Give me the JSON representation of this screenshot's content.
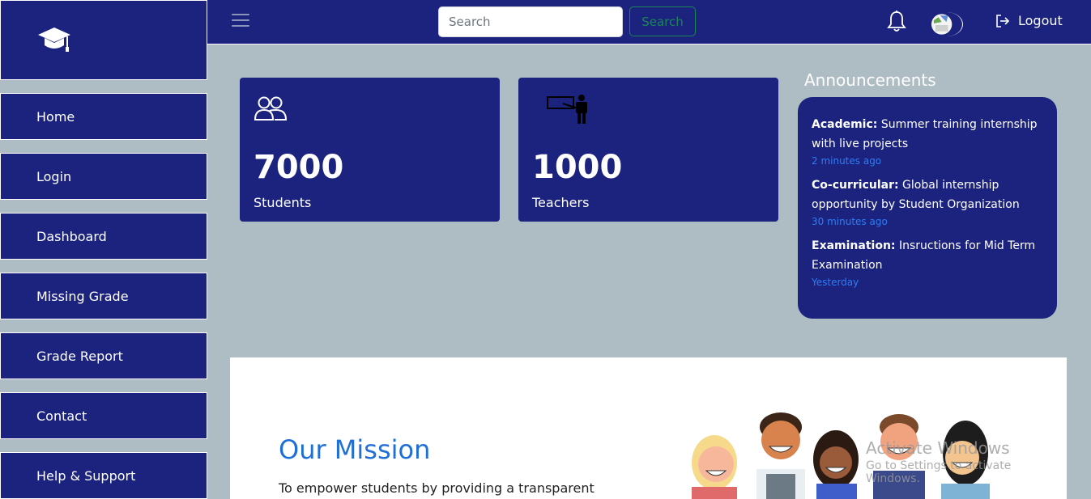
{
  "sidebar": {
    "logo_icon": "graduation-cap-icon",
    "items": [
      {
        "label": "Home"
      },
      {
        "label": "Login"
      },
      {
        "label": "Dashboard"
      },
      {
        "label": "Missing Grade"
      },
      {
        "label": "Grade Report"
      },
      {
        "label": "Contact"
      },
      {
        "label": "Help & Support"
      }
    ]
  },
  "topbar": {
    "search_placeholder": "Search",
    "search_button": "Search",
    "logout_label": "Logout"
  },
  "cards": [
    {
      "value": "7000",
      "label": "Students",
      "icon": "users-icon"
    },
    {
      "value": "1000",
      "label": "Teachers",
      "icon": "teacher-icon"
    }
  ],
  "announcements": {
    "title": "Announcements",
    "items": [
      {
        "category": "Academic:",
        "text": " Summer training internship with live projects",
        "time": "2 minutes ago"
      },
      {
        "category": "Co-curricular:",
        "text": " Global internship opportunity by Student Organization",
        "time": "30 minutes ago"
      },
      {
        "category": "Examination:",
        "text": " Insructions for Mid Term Examination",
        "time": "Yesterday"
      }
    ]
  },
  "mission": {
    "title": "Our Mission",
    "text": "To empower students by providing a transparent"
  },
  "watermark": {
    "line1": "Activate Windows",
    "line2": "Go to Settings to activate Windows."
  },
  "colors": {
    "primary": "#1b237e",
    "background": "#aebcc4",
    "accent_blue": "#1f6fd6",
    "success": "#198754"
  }
}
